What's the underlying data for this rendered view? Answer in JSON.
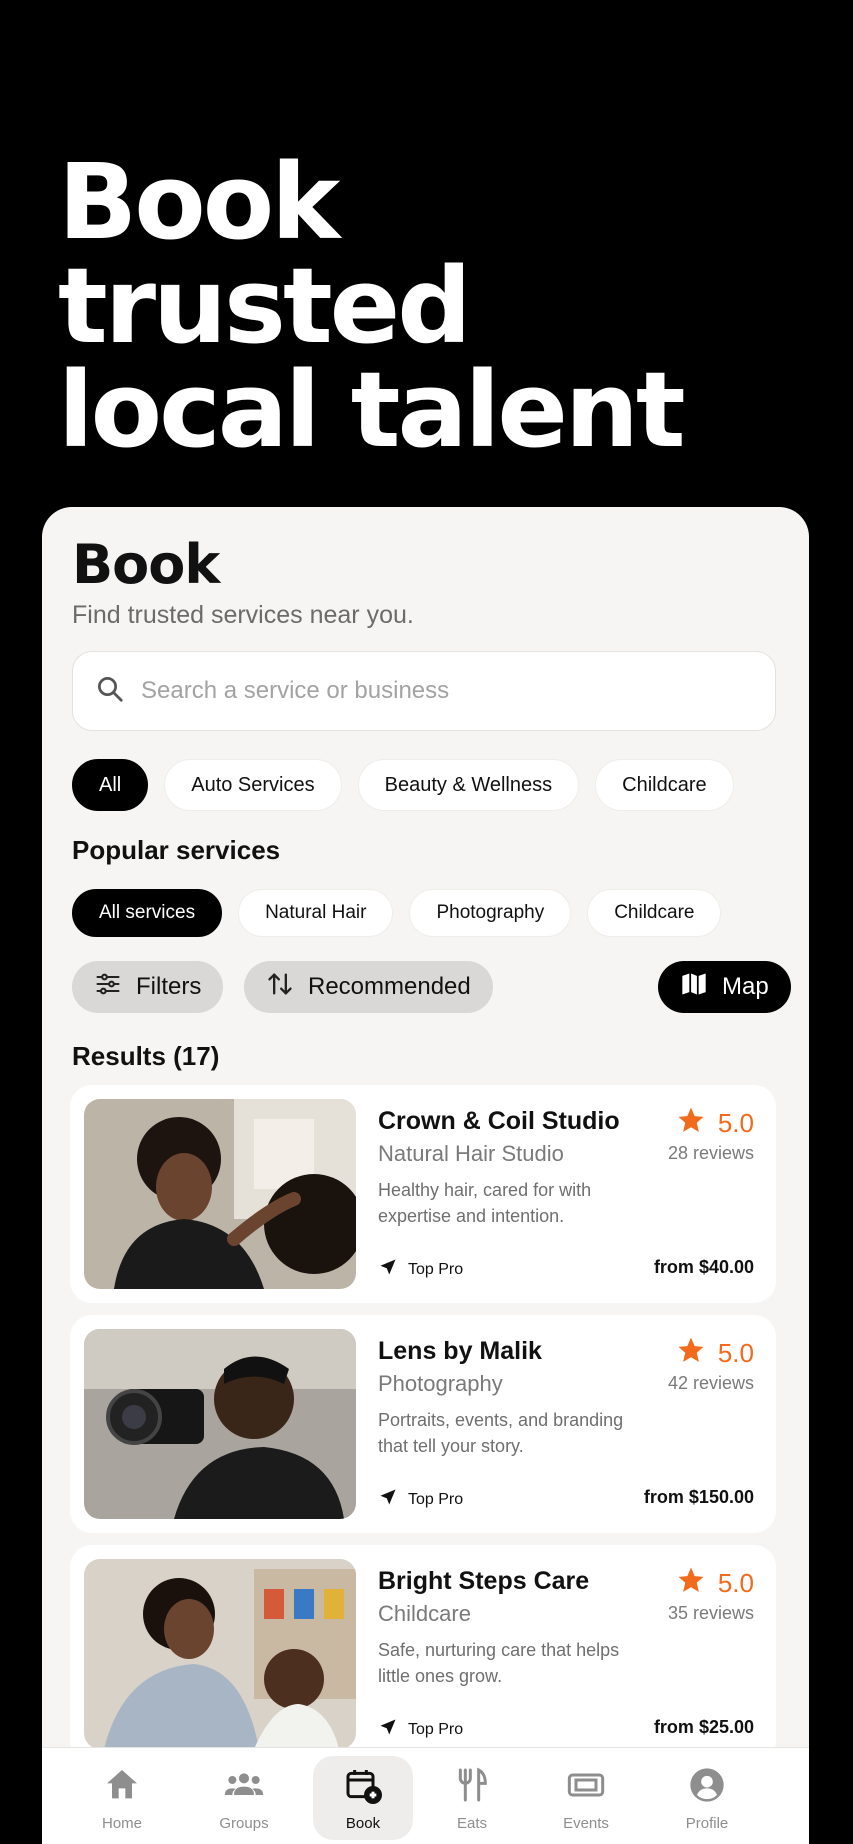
{
  "hero": {
    "lines": [
      "Book",
      "trusted",
      "local talent"
    ]
  },
  "page": {
    "title": "Book",
    "subtitle": "Find trusted services near you.",
    "search_placeholder": "Search a service or business"
  },
  "categories": [
    "All",
    "Auto Services",
    "Beauty & Wellness",
    "Childcare"
  ],
  "popular": {
    "label": "Popular services",
    "items": [
      "All services",
      "Natural Hair",
      "Photography",
      "Childcare"
    ]
  },
  "toolbar": {
    "filters": "Filters",
    "sort": "Recommended",
    "map": "Map"
  },
  "results_label": "Results (17)",
  "results": [
    {
      "name": "Crown & Coil Studio",
      "category": "Natural Hair Studio",
      "desc": "Healthy hair, cared for with expertise and intention.",
      "rating": "5.0",
      "reviews": "28 reviews",
      "badge": "Top Pro",
      "price": "from $40.00"
    },
    {
      "name": "Lens by Malik",
      "category": "Photography",
      "desc": "Portraits, events, and branding that tell your story.",
      "rating": "5.0",
      "reviews": "42 reviews",
      "badge": "Top Pro",
      "price": "from $150.00"
    },
    {
      "name": "Bright Steps Care",
      "category": "Childcare",
      "desc": "Safe, nurturing care that helps little ones grow.",
      "rating": "5.0",
      "reviews": "35 reviews",
      "badge": "Top Pro",
      "price": "from $25.00"
    }
  ],
  "tabs": [
    "Home",
    "Groups",
    "Book",
    "Eats",
    "Events",
    "Profile"
  ],
  "colors": {
    "accent": "#f26a1b",
    "background": "#f6f5f3",
    "dark": "#000000"
  }
}
